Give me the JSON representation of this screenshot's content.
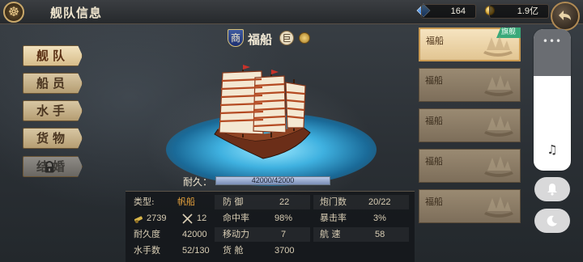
{
  "header": {
    "title": "舰队信息",
    "gems": "164",
    "gold": "1.9亿"
  },
  "menu": [
    {
      "label": "舰队",
      "state": "active"
    },
    {
      "label": "船员",
      "state": "normal"
    },
    {
      "label": "水手",
      "state": "normal"
    },
    {
      "label": "货物",
      "state": "normal"
    },
    {
      "label": "结婚",
      "state": "locked"
    }
  ],
  "ship": {
    "type_badge": "商",
    "name": "福船",
    "tier": "巨",
    "durability_label": "耐久：",
    "durability_text": "42000/42000",
    "durability_fraction": 1.0
  },
  "stats": {
    "type_label": "类型:",
    "type_value": "帆船",
    "cost_value": "2739",
    "attack_value": "12",
    "durability_label": "耐久度",
    "durability_value": "42000",
    "sailors_label": "水手数",
    "sailors_value": "52/130",
    "defense_label": "防 御",
    "defense_value": "22",
    "accuracy_label": "命中率",
    "accuracy_value": "98%",
    "mobility_label": "移动力",
    "mobility_value": "7",
    "cargo_label": "货 舱",
    "cargo_value": "3700",
    "cannons_label": "炮门数",
    "cannons_value": "20/22",
    "crit_label": "暴击率",
    "crit_value": "3%",
    "speed_label": "航 速",
    "speed_value": "58"
  },
  "fleet": [
    {
      "label": "福船",
      "active": true,
      "badge": "旗舰"
    },
    {
      "label": "福船",
      "active": false
    },
    {
      "label": "福船",
      "active": false
    },
    {
      "label": "福船",
      "active": false
    },
    {
      "label": "福船",
      "active": false
    }
  ],
  "icons": {
    "wheel": "ship-wheel-icon",
    "gem": "gem-icon",
    "gold": "gold-coin-icon",
    "back": "back-arrow-icon",
    "lock": "lock-icon",
    "music": "music-note-icon",
    "bell": "bell-icon",
    "moon": "moon-icon"
  },
  "colors": {
    "accent_gold": "#c9a86a",
    "highlight_value": "#e6a23c",
    "flagship_badge": "#3aa97a",
    "water": "#3fb1e0"
  }
}
